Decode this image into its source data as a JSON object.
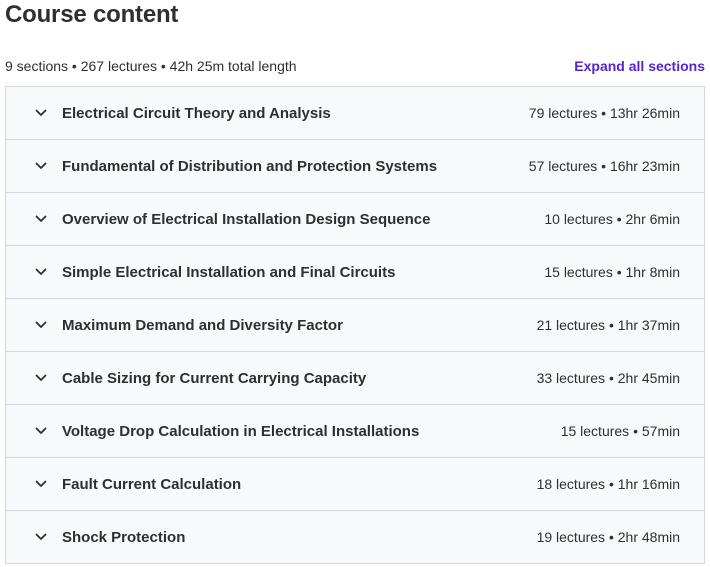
{
  "header": {
    "title": "Course content"
  },
  "summary": {
    "text": "9 sections • 267 lectures • 42h 25m total length",
    "expand_label": "Expand all sections"
  },
  "colors": {
    "accent": "#5624d0",
    "section_bg": "#f7f9fa",
    "border": "#d1d7dc",
    "text": "#2d2f31"
  },
  "sections": [
    {
      "title": "Electrical Circuit Theory and Analysis",
      "meta": "79 lectures • 13hr 26min",
      "icon": "chevron-down-icon"
    },
    {
      "title": "Fundamental of Distribution and Protection Systems",
      "meta": "57 lectures • 16hr 23min",
      "icon": "chevron-down-icon"
    },
    {
      "title": "Overview of Electrical Installation Design Sequence",
      "meta": "10 lectures • 2hr 6min",
      "icon": "chevron-down-icon"
    },
    {
      "title": "Simple Electrical Installation and Final Circuits",
      "meta": "15 lectures • 1hr 8min",
      "icon": "chevron-down-icon"
    },
    {
      "title": "Maximum Demand and Diversity Factor",
      "meta": "21 lectures • 1hr 37min",
      "icon": "chevron-down-icon"
    },
    {
      "title": "Cable Sizing for Current Carrying Capacity",
      "meta": "33 lectures • 2hr 45min",
      "icon": "chevron-down-icon"
    },
    {
      "title": "Voltage Drop Calculation in Electrical Installations",
      "meta": "15 lectures • 57min",
      "icon": "chevron-down-icon"
    },
    {
      "title": "Fault Current Calculation",
      "meta": "18 lectures • 1hr 16min",
      "icon": "chevron-down-icon"
    },
    {
      "title": "Shock Protection",
      "meta": "19 lectures • 2hr 48min",
      "icon": "chevron-down-icon"
    }
  ]
}
